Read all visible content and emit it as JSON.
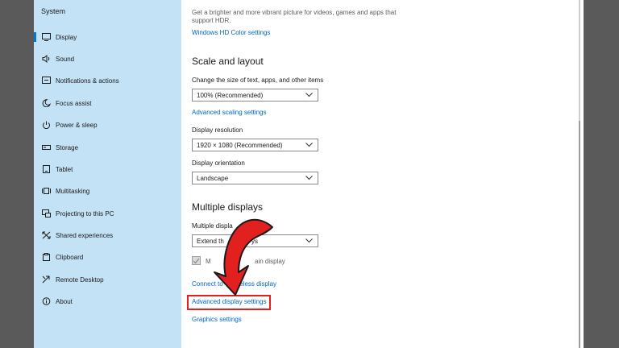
{
  "sidebar": {
    "title": "System",
    "items": [
      {
        "label": "Display",
        "icon": "display-icon",
        "selected": true
      },
      {
        "label": "Sound",
        "icon": "speaker-icon"
      },
      {
        "label": "Notifications & actions",
        "icon": "notifications-icon"
      },
      {
        "label": "Focus assist",
        "icon": "moon-icon"
      },
      {
        "label": "Power & sleep",
        "icon": "power-icon"
      },
      {
        "label": "Storage",
        "icon": "storage-icon"
      },
      {
        "label": "Tablet",
        "icon": "tablet-icon"
      },
      {
        "label": "Multitasking",
        "icon": "multitasking-icon"
      },
      {
        "label": "Projecting to this PC",
        "icon": "projecting-icon"
      },
      {
        "label": "Shared experiences",
        "icon": "shared-experiences-icon"
      },
      {
        "label": "Clipboard",
        "icon": "clipboard-icon"
      },
      {
        "label": "Remote Desktop",
        "icon": "remote-desktop-icon"
      },
      {
        "label": "About",
        "icon": "info-icon"
      }
    ]
  },
  "hdr": {
    "description_line1": "Get a brighter and more vibrant picture for videos, games and apps that",
    "description_line2": "support HDR.",
    "link": "Windows HD Color settings"
  },
  "scale_layout": {
    "heading": "Scale and layout",
    "scale_label": "Change the size of text, apps, and other items",
    "scale_value": "100% (Recommended)",
    "advanced_scaling_link": "Advanced scaling settings",
    "resolution_label": "Display resolution",
    "resolution_value": "1920 × 1080 (Recommended)",
    "orientation_label": "Display orientation",
    "orientation_value": "Landscape"
  },
  "multiple_displays": {
    "heading": "Multiple displays",
    "label_visible": "Multiple displa",
    "dropdown_visible": "Extend th",
    "dropdown_visible_end": "ys",
    "checkbox_visible_start": "M",
    "checkbox_visible_end": "ain display",
    "connect_start": "Connect to",
    "connect_end": "wireless display",
    "advanced_display_link": "Advanced display settings",
    "graphics_link": "Graphics settings"
  },
  "colors": {
    "sidebar_bg": "#c3e2f5",
    "link": "#0067c0",
    "accent": "#0078d7",
    "annotation_red": "#e32020"
  }
}
